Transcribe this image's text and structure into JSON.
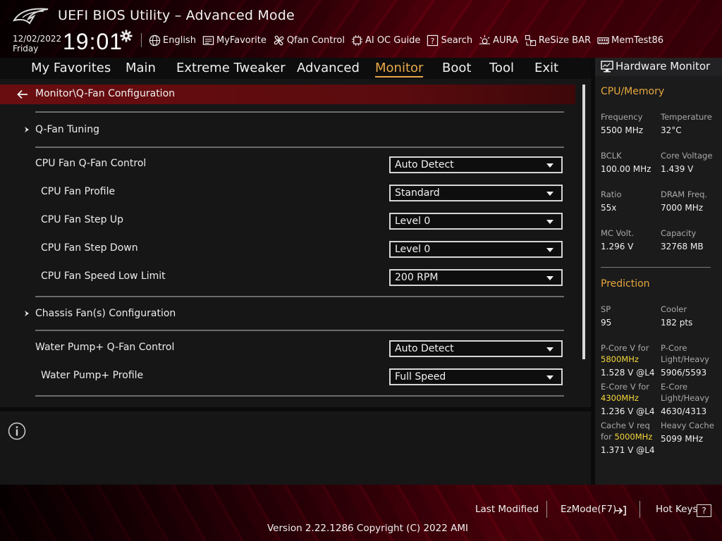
{
  "header": {
    "title": "UEFI BIOS Utility – Advanced Mode",
    "date": "12/02/2022",
    "day": "Friday",
    "time": "19:01"
  },
  "toolbar": {
    "items": [
      {
        "label": "English",
        "icon": "globe-icon"
      },
      {
        "label": "MyFavorite",
        "icon": "favorite-icon"
      },
      {
        "label": "Qfan Control",
        "icon": "fan-icon"
      },
      {
        "label": "AI OC Guide",
        "icon": "ai-chip-icon"
      },
      {
        "label": "Search",
        "icon": "search-help-icon"
      },
      {
        "label": "AURA",
        "icon": "aura-icon"
      },
      {
        "label": "ReSize BAR",
        "icon": "resize-bar-icon"
      },
      {
        "label": "MemTest86",
        "icon": "memory-icon"
      }
    ]
  },
  "menu": {
    "tabs": [
      {
        "label": "My Favorites"
      },
      {
        "label": "Main"
      },
      {
        "label": "Extreme Tweaker"
      },
      {
        "label": "Advanced"
      },
      {
        "label": "Monitor",
        "active": true
      },
      {
        "label": "Boot"
      },
      {
        "label": "Tool"
      },
      {
        "label": "Exit"
      }
    ]
  },
  "breadcrumb": "Monitor\\Q-Fan Configuration",
  "settings": {
    "qfan_tuning": "Q-Fan Tuning",
    "cpu_fan_qfan_control": {
      "label": "CPU Fan Q-Fan Control",
      "value": "Auto Detect"
    },
    "cpu_fan_profile": {
      "label": "CPU Fan Profile",
      "value": "Standard"
    },
    "cpu_fan_step_up": {
      "label": "CPU Fan Step Up",
      "value": "Level 0"
    },
    "cpu_fan_step_down": {
      "label": "CPU Fan Step Down",
      "value": "Level 0"
    },
    "cpu_fan_speed_low_limit": {
      "label": "CPU Fan Speed Low Limit",
      "value": "200 RPM"
    },
    "chassis_fans": "Chassis Fan(s) Configuration",
    "water_pump_qfan_control": {
      "label": "Water Pump+ Q-Fan Control",
      "value": "Auto Detect"
    },
    "water_pump_profile": {
      "label": "Water Pump+ Profile",
      "value": "Full Speed"
    }
  },
  "hardware_monitor": {
    "title": "Hardware Monitor",
    "cpu_memory": {
      "title": "CPU/Memory",
      "frequency": {
        "label": "Frequency",
        "value": "5500 MHz"
      },
      "temperature": {
        "label": "Temperature",
        "value": "32°C"
      },
      "bclk": {
        "label": "BCLK",
        "value": "100.00 MHz"
      },
      "core_voltage": {
        "label": "Core Voltage",
        "value": "1.439 V"
      },
      "ratio": {
        "label": "Ratio",
        "value": "55x"
      },
      "dram_freq": {
        "label": "DRAM Freq.",
        "value": "7000 MHz"
      },
      "mc_volt": {
        "label": "MC Volt.",
        "value": "1.296 V"
      },
      "capacity": {
        "label": "Capacity",
        "value": "32768 MB"
      }
    },
    "prediction": {
      "title": "Prediction",
      "sp": {
        "label": "SP",
        "value": "95"
      },
      "cooler": {
        "label": "Cooler",
        "value": "182 pts"
      },
      "pcore_v": {
        "label_line1": "P-Core V for",
        "freq": "5800MHz",
        "value": "1.528 V @L4"
      },
      "pcore_lh": {
        "label_line1": "P-Core",
        "label_line2": "Light/Heavy",
        "value": "5906/5593"
      },
      "ecore_v": {
        "label_line1": "E-Core V for",
        "freq": "4300MHz",
        "value": "1.236 V @L4"
      },
      "ecore_lh": {
        "label_line1": "E-Core",
        "label_line2": "Light/Heavy",
        "value": "4630/4313"
      },
      "cache_v": {
        "label_line1": "Cache V req",
        "label_prefix": "for",
        "freq": "5000MHz",
        "value": "1.371 V @L4"
      },
      "heavy_cache": {
        "label": "Heavy Cache",
        "value": "5099 MHz"
      }
    }
  },
  "footer": {
    "last_modified": "Last Modified",
    "ezmode": "EzMode(F7)",
    "hotkeys": "Hot Keys",
    "hotkeys_key": "?",
    "version": "Version 2.22.1286 Copyright (C) 2022 AMI"
  },
  "colors": {
    "accent": "#e8a84a",
    "highlight": "#f5d63a",
    "breadcrumb": "#6a0d10"
  }
}
